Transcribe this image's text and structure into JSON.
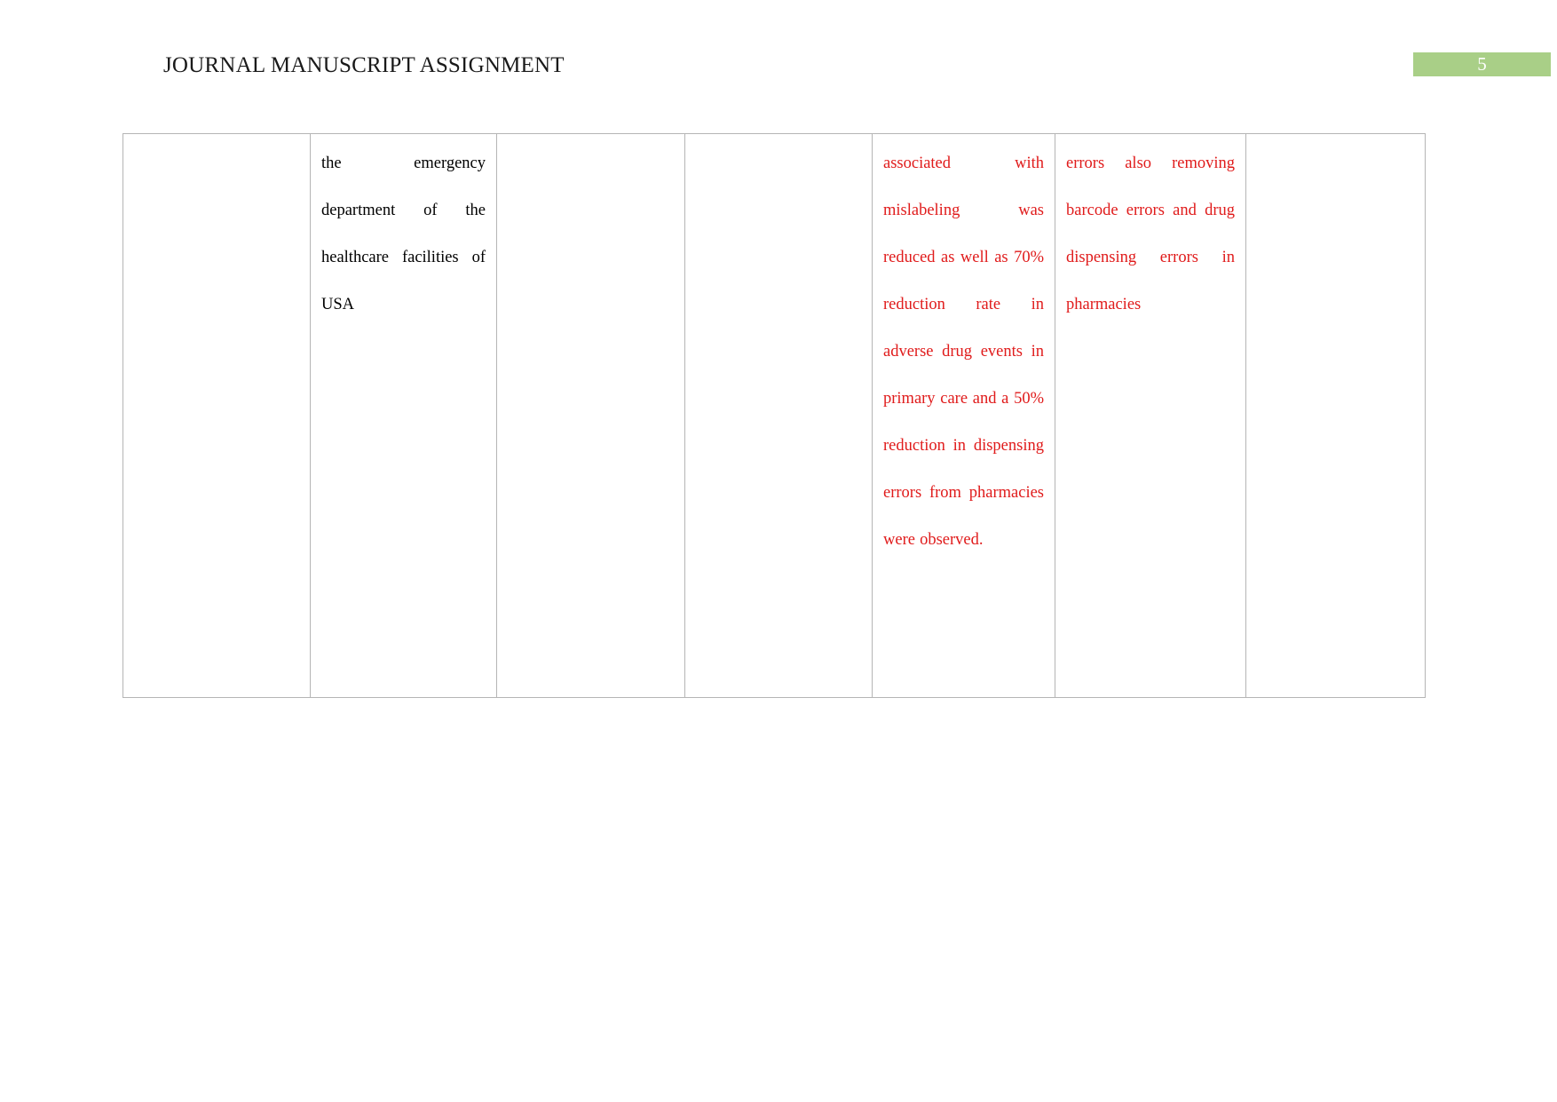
{
  "document": {
    "header": {
      "title": "JOURNAL MANUSCRIPT ASSIGNMENT",
      "page_number": "5",
      "badge_color": "#a9cf87",
      "badge_text_color": "#ffffff"
    },
    "colors": {
      "body_text": "#000000",
      "highlight_text": "#e01b1b",
      "table_border": "#b5b5b5",
      "page_background": "#ffffff"
    },
    "table": {
      "column_count": 7,
      "row_count": 1,
      "rows": [
        {
          "cells": [
            {
              "text": "",
              "color": "black"
            },
            {
              "text": "the emergency department of the healthcare facilities of USA",
              "color": "black"
            },
            {
              "text": "",
              "color": "black"
            },
            {
              "text": "",
              "color": "black"
            },
            {
              "text": "associated with mislabeling was reduced as well as 70% reduction rate in adverse drug events in primary care and a 50% reduction in dispensing errors from pharmacies were observed.",
              "color": "red"
            },
            {
              "text": "errors also removing barcode errors and drug dispensing errors in pharmacies",
              "color": "red"
            },
            {
              "text": "",
              "color": "black"
            }
          ]
        }
      ]
    }
  }
}
